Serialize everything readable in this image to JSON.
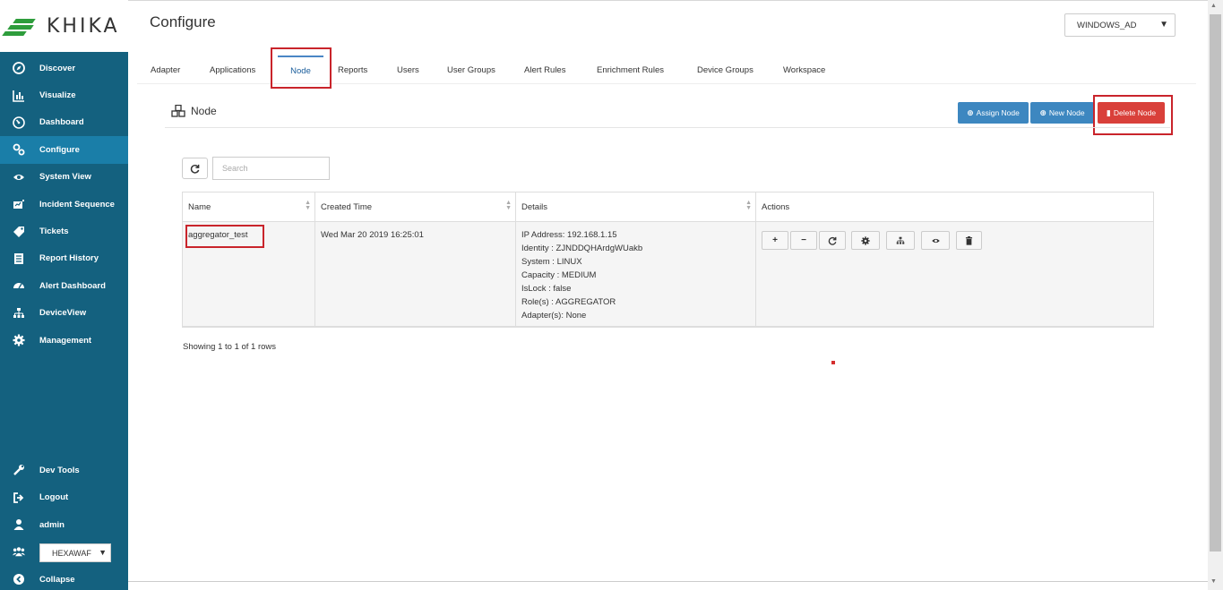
{
  "brand": {
    "name": "KHIKA"
  },
  "sidebar": {
    "items": [
      {
        "label": "Discover",
        "icon": "compass-icon"
      },
      {
        "label": "Visualize",
        "icon": "bar-chart-icon"
      },
      {
        "label": "Dashboard",
        "icon": "dashboard-icon"
      },
      {
        "label": "Configure",
        "icon": "cogs-icon",
        "active": true
      },
      {
        "label": "System View",
        "icon": "eye-icon"
      },
      {
        "label": "Incident Sequence",
        "icon": "sequence-icon"
      },
      {
        "label": "Tickets",
        "icon": "tag-icon"
      },
      {
        "label": "Report History",
        "icon": "list-icon"
      },
      {
        "label": "Alert Dashboard",
        "icon": "gauge-icon"
      },
      {
        "label": "DeviceView",
        "icon": "sitemap-icon"
      },
      {
        "label": "Management",
        "icon": "gear-icon"
      }
    ],
    "bottom_items": [
      {
        "label": "Dev Tools",
        "icon": "wrench-icon"
      },
      {
        "label": "Logout",
        "icon": "logout-icon"
      },
      {
        "label": "admin",
        "icon": "user-icon"
      }
    ],
    "tenant_select": "HEXAWAF",
    "collapse_label": "Collapse"
  },
  "header": {
    "title": "Configure",
    "workspace_select": "WINDOWS_AD"
  },
  "tabs": [
    {
      "label": "Adapter"
    },
    {
      "label": "Applications"
    },
    {
      "label": "Node",
      "active": true
    },
    {
      "label": "Reports"
    },
    {
      "label": "Users"
    },
    {
      "label": "User Groups"
    },
    {
      "label": "Alert Rules"
    },
    {
      "label": "Enrichment Rules"
    },
    {
      "label": "Device Groups"
    },
    {
      "label": "Workspace"
    }
  ],
  "panel": {
    "title": "Node",
    "assign_label": "Assign Node",
    "new_label": "New Node",
    "delete_label": "Delete Node"
  },
  "search": {
    "placeholder": "Search"
  },
  "table": {
    "columns": [
      "Name",
      "Created Time",
      "Details",
      "Actions"
    ],
    "rows": [
      {
        "name": "aggregator_test",
        "created": "Wed Mar 20 2019 16:25:01",
        "details": [
          "IP Address: 192.168.1.15",
          "Identity : ZJNDDQHArdgWUakb",
          "System : LINUX",
          "Capacity : MEDIUM",
          "IsLock : false",
          "Role(s) : AGGREGATOR",
          "Adapter(s): None"
        ]
      }
    ]
  },
  "footer": {
    "showing": "Showing 1 to 1 of 1 rows"
  },
  "colors": {
    "sidebar": "#14617f",
    "active": "#1a7ea8",
    "primary": "#3d87c0",
    "danger": "#d9403a",
    "highlight": "#c9242b"
  }
}
